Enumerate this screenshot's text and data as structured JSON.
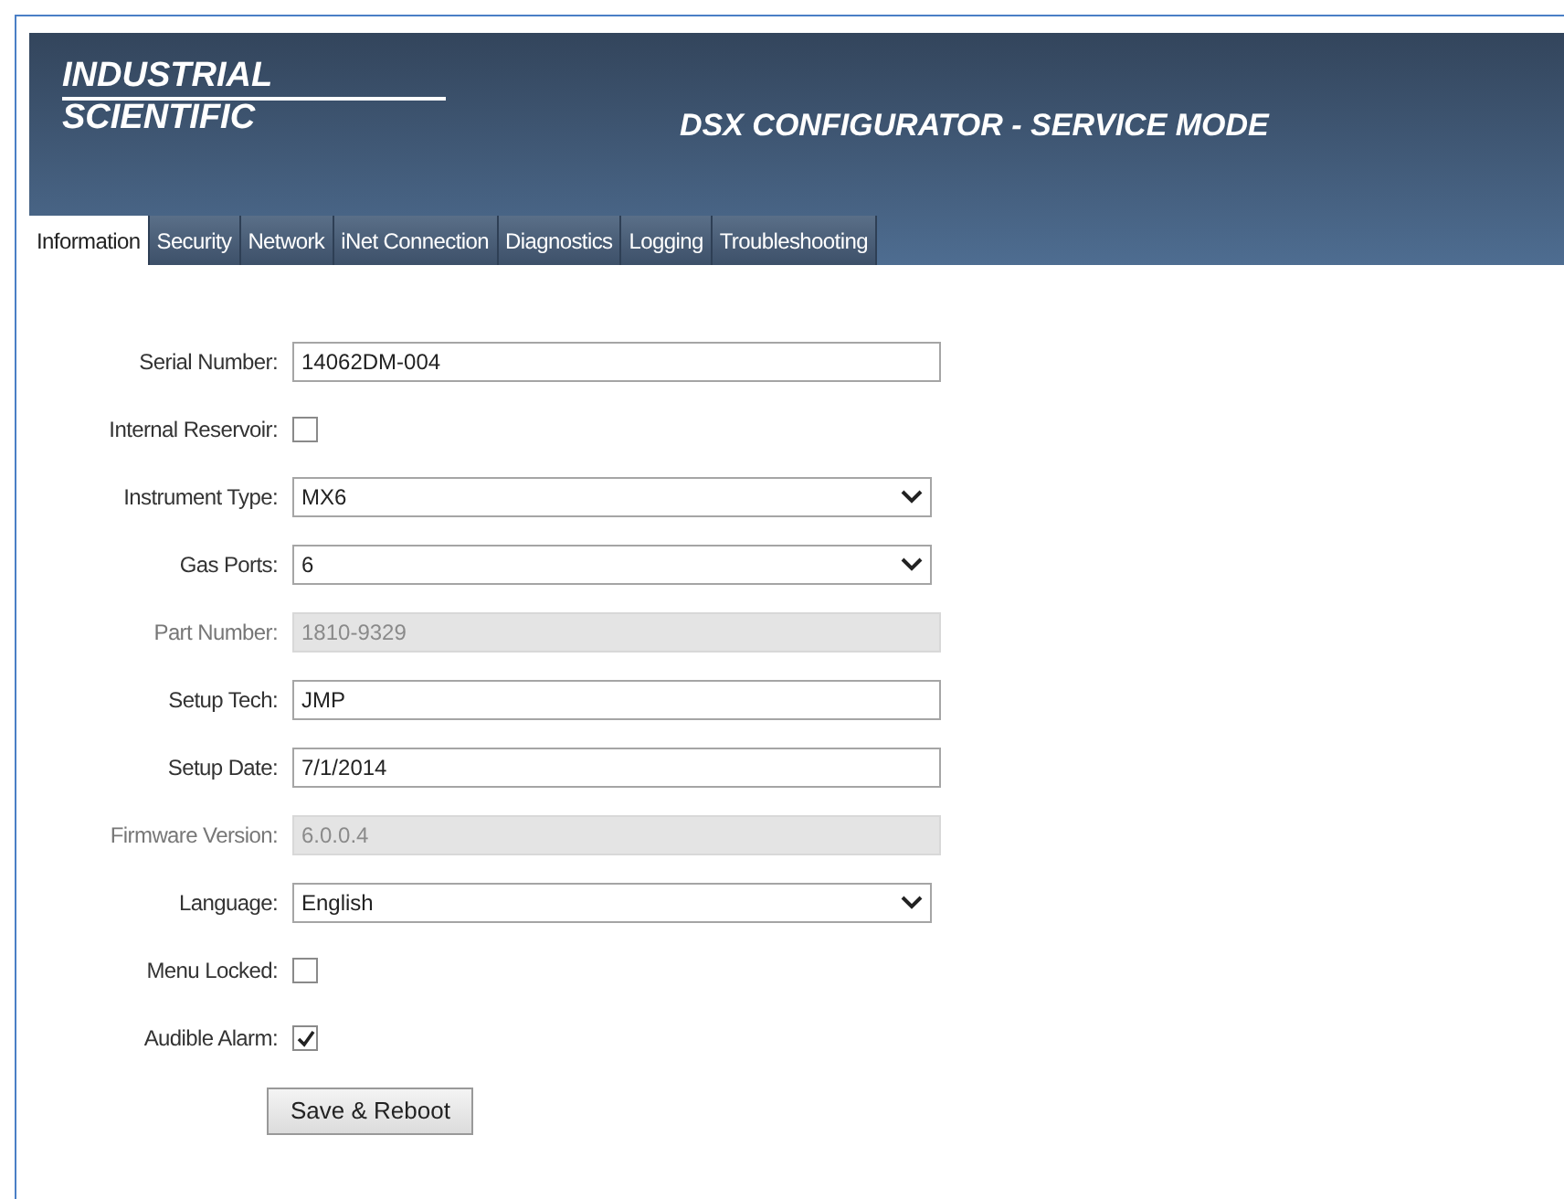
{
  "header": {
    "logo_line_1": "INDUSTRIAL",
    "logo_line_2": "SCIENTIFIC",
    "title": "DSX CONFIGURATOR - SERVICE MODE"
  },
  "tabs": [
    {
      "label": "Information",
      "selected": true
    },
    {
      "label": "Security",
      "selected": false
    },
    {
      "label": "Network",
      "selected": false
    },
    {
      "label": "iNet Connection",
      "selected": false
    },
    {
      "label": "Diagnostics",
      "selected": false
    },
    {
      "label": "Logging",
      "selected": false
    },
    {
      "label": "Troubleshooting",
      "selected": false
    }
  ],
  "fields": [
    {
      "kind": "text",
      "label": "Serial Number:",
      "value": "14062DM-004",
      "disabled": false
    },
    {
      "kind": "checkbox",
      "label": "Internal Reservoir:",
      "checked": false
    },
    {
      "kind": "select",
      "label": "Instrument Type:",
      "value": "MX6"
    },
    {
      "kind": "select",
      "label": "Gas Ports:",
      "value": "6"
    },
    {
      "kind": "text",
      "label": "Part Number:",
      "value": "1810-9329",
      "disabled": true
    },
    {
      "kind": "text",
      "label": "Setup Tech:",
      "value": "JMP",
      "disabled": false
    },
    {
      "kind": "text",
      "label": "Setup Date:",
      "value": "7/1/2014",
      "disabled": false
    },
    {
      "kind": "text",
      "label": "Firmware Version:",
      "value": "6.0.0.4",
      "disabled": true
    },
    {
      "kind": "select",
      "label": "Language:",
      "value": "English"
    },
    {
      "kind": "checkbox",
      "label": "Menu Locked:",
      "checked": false
    },
    {
      "kind": "checkbox",
      "label": "Audible Alarm:",
      "checked": true
    }
  ],
  "save_button": "Save & Reboot"
}
